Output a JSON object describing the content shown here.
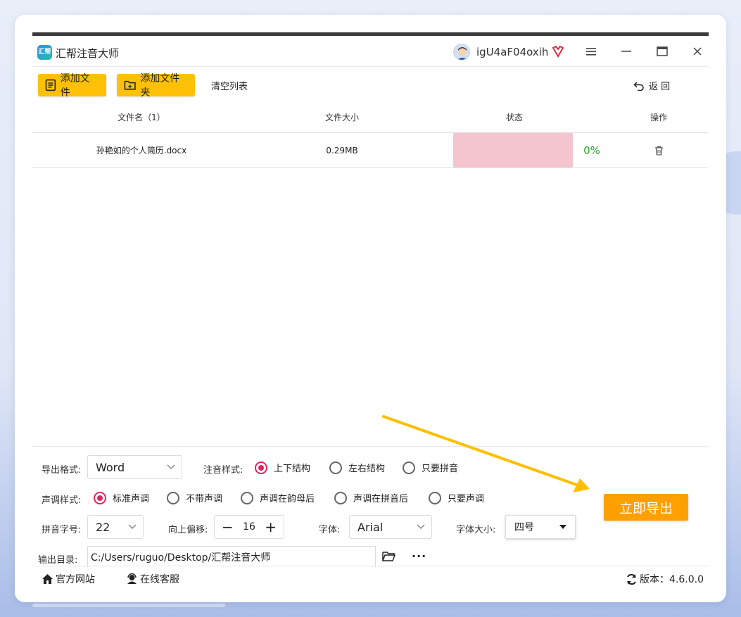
{
  "app": {
    "title": "汇帮注音大师",
    "logo_text": "汇帮"
  },
  "user": {
    "name": "igU4aF04oxih"
  },
  "toolbar": {
    "add_file": "添加文件",
    "add_folder": "添加文件夹",
    "clear_list": "清空列表",
    "back": "返 回"
  },
  "table": {
    "headers": [
      "文件名（1）",
      "文件大小",
      "状态",
      "操作"
    ],
    "rows": [
      {
        "name": "孙艳如的个人简历.docx",
        "size": "0.29MB",
        "progress": 0,
        "progress_text": "0%"
      }
    ]
  },
  "settings": {
    "export_format_label": "导出格式:",
    "export_format_value": "Word",
    "annot_style_label": "注音样式:",
    "annot_style_options": [
      "上下结构",
      "左右结构",
      "只要拼音"
    ],
    "annot_style_selected": 0,
    "tone_style_label": "声调样式:",
    "tone_style_options": [
      "标准声调",
      "不带声调",
      "声调在韵母后",
      "声调在拼音后",
      "只要声调"
    ],
    "tone_style_selected": 0,
    "pinyin_size_label": "拼音字号:",
    "pinyin_size_value": "22",
    "offset_label": "向上偏移:",
    "offset_value": "16",
    "font_label": "字体:",
    "font_value": "Arial",
    "font_size_label": "字体大小:",
    "font_size_value": "四号",
    "output_label": "输出目录:",
    "output_path": "C:/Users/ruguo/Desktop/汇帮注音大师",
    "export_button": "立即导出"
  },
  "statusbar": {
    "website": "官方网站",
    "support": "在线客服",
    "version": "版本：4.6.0.0"
  },
  "colors": {
    "accent_yellow": "#ffc107",
    "export_orange": "#ffa000",
    "radio_pink": "#e0245e",
    "progress_green": "#2aa52a"
  }
}
